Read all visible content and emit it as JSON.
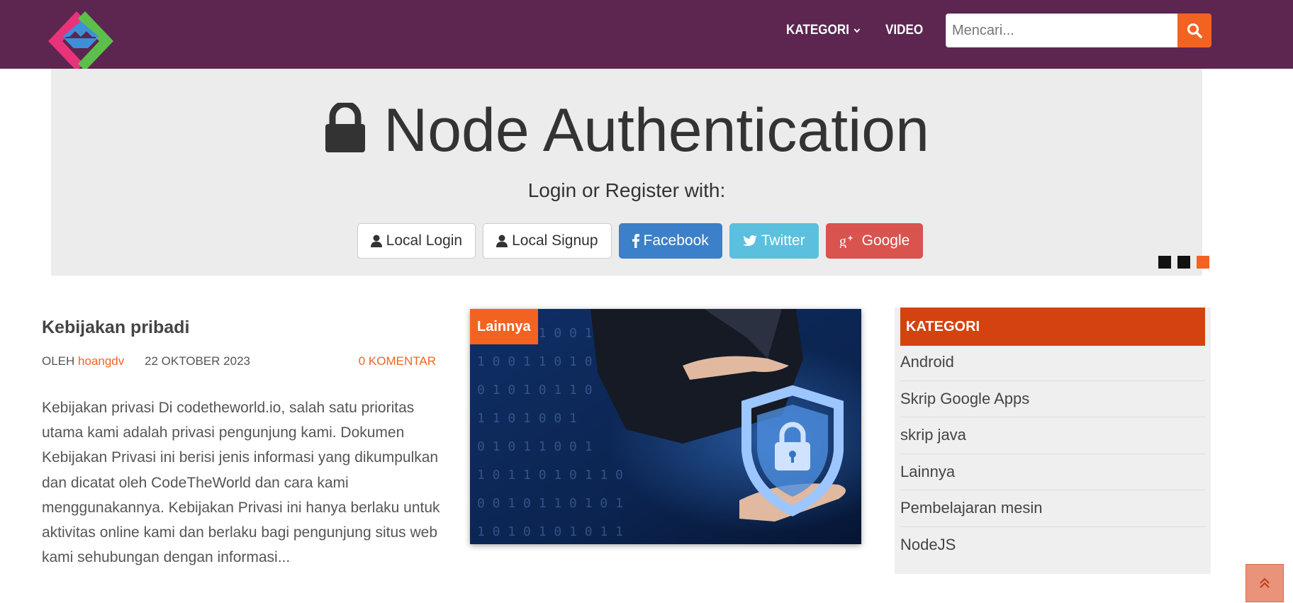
{
  "header": {
    "logo_icon": "site-logo-icon",
    "nav": {
      "kategori_label": "KATEGORI",
      "video_label": "VIDEO"
    },
    "search": {
      "placeholder": "Mencari...",
      "value": "",
      "button_icon": "search-icon"
    }
  },
  "slider": {
    "title": "Node Authentication",
    "subtitle": "Login or Register with:",
    "buttons": [
      {
        "label": "Local Login",
        "icon": "user-icon"
      },
      {
        "label": "Local Signup",
        "icon": "user-icon"
      },
      {
        "label": "Facebook",
        "icon": "facebook-icon"
      },
      {
        "label": "Twitter",
        "icon": "twitter-icon"
      },
      {
        "label": "Google",
        "icon": "google-plus-icon"
      }
    ],
    "dots": {
      "count": 3,
      "active_index": 2
    }
  },
  "post": {
    "title": "Kebijakan pribadi",
    "by_label": "OLEH",
    "author": "hoangdv",
    "date": "22 OKTOBER 2023",
    "comments": "0 KOMENTAR",
    "excerpt": "Kebijakan privasi Di codetheworld.io, salah satu prioritas utama kami adalah privasi pengunjung kami. Dokumen Kebijakan Privasi ini berisi jenis informasi yang dikumpulkan dan dicatat oleh CodeTheWorld dan cara kami menggunakannya. Kebijakan Privasi ini hanya berlaku untuk aktivitas online kami dan berlaku bagi pengunjung situs web kami sehubungan dengan informasi...",
    "category_badge": "Lainnya"
  },
  "sidebar": {
    "heading": "KATEGORI",
    "items": [
      "Android",
      "Skrip Google Apps",
      "skrip java",
      "Lainnya",
      "Pembelajaran mesin",
      "NodeJS"
    ]
  },
  "colors": {
    "header_bg": "#5c2650",
    "accent": "#f26322",
    "sidebar_head": "#d4420f"
  },
  "back_to_top_icon": "double-chevron-up-icon"
}
